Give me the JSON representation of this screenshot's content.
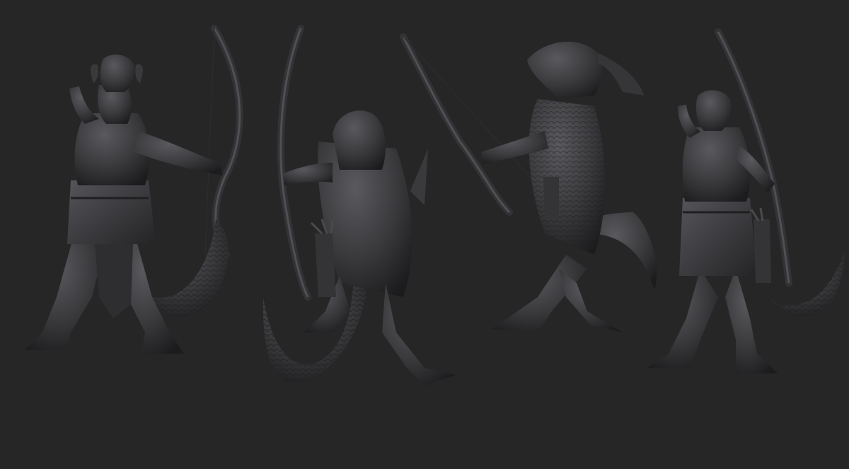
{
  "scene": {
    "subject": "lizardfolk-archer-miniature-sculpt",
    "background_color": "#262626",
    "material_color": "#3d3d40",
    "views": [
      {
        "name": "front-view",
        "pose": "standing-holding-bow"
      },
      {
        "name": "back-view",
        "pose": "rear-with-quiver-and-tail"
      },
      {
        "name": "side-view",
        "pose": "lunging-with-bow"
      },
      {
        "name": "three-quarter-view",
        "pose": "standing-holding-bow"
      }
    ]
  }
}
